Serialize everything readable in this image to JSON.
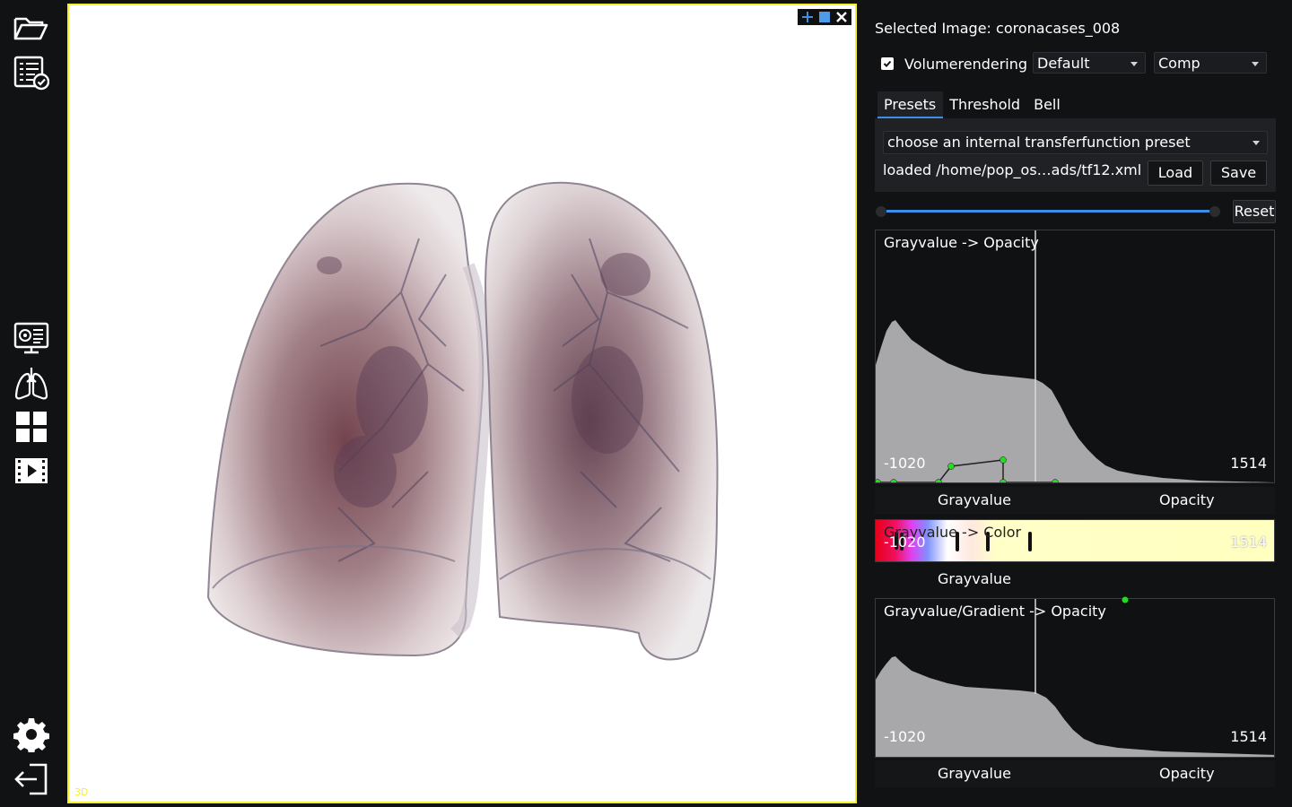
{
  "toolbar": {
    "items": [
      {
        "name": "open-folder-icon"
      },
      {
        "name": "checklist-icon"
      },
      {
        "name": "monitor-view-icon"
      },
      {
        "name": "lungs-icon"
      },
      {
        "name": "grid-layout-icon"
      },
      {
        "name": "video-player-icon"
      },
      {
        "name": "gear-icon"
      },
      {
        "name": "exit-icon"
      }
    ]
  },
  "viewer": {
    "label": "3D",
    "border_color": "#f5f02a",
    "buttons": [
      "crosshair-icon",
      "maximize-icon",
      "close-icon"
    ]
  },
  "panel": {
    "selected_image": "Selected Image: coronacases_008",
    "volumerendering": {
      "label": "Volumerendering",
      "checked": true,
      "mode": "Default",
      "blend": "Comp"
    },
    "tabs": [
      {
        "label": "Presets",
        "active": true
      },
      {
        "label": "Threshold",
        "active": false
      },
      {
        "label": "Bell",
        "active": false
      }
    ],
    "preset_combo": "choose an internal transferfunction preset",
    "loaded_text": "loaded /home/pop_os…ads/tf12.xml",
    "load_button": "Load",
    "save_button": "Save",
    "reset_button": "Reset",
    "opacity_plot": {
      "title": "Grayvalue -> Opacity",
      "min": "-1020",
      "max": "1514",
      "xlabel": "Grayvalue",
      "ylabel": "Opacity"
    },
    "color_plot": {
      "title": "Grayvalue -> Color",
      "min": "-1020",
      "max": "1514",
      "xlabel": "Grayvalue"
    },
    "gradient_plot": {
      "title": "Grayvalue/Gradient -> Opacity",
      "min": "-1020",
      "max": "1514",
      "xlabel": "Grayvalue",
      "ylabel": "Opacity"
    },
    "accent_color": "#3d8ee8",
    "control_point_color": "#22dd22"
  }
}
